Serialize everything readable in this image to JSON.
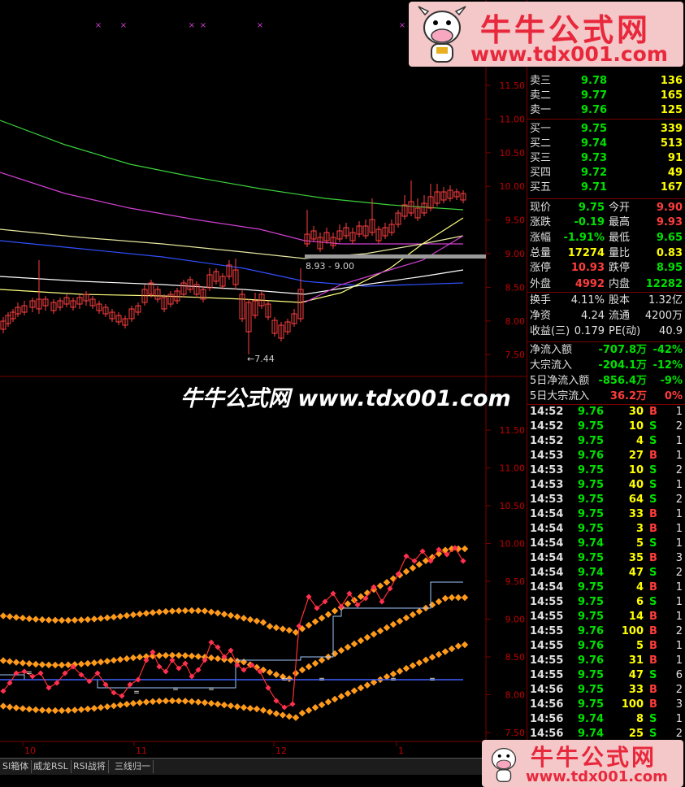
{
  "watermark": {
    "brand": "牛牛公式网",
    "site": "www.tdx001.com",
    "center_text": "牛牛公式网 www.tdx001.com"
  },
  "main_chart": {
    "price_labels": [
      "11.50",
      "11.00",
      "10.50",
      "10.00",
      "9.50",
      "9.00",
      "8.50",
      "8.00",
      "7.50"
    ],
    "low_note": "←7.44",
    "range_note": "8.93 - 9.00"
  },
  "sub_chart": {
    "price_labels": [
      "11.50",
      "11.00",
      "10.50",
      "10.00",
      "9.50",
      "9.00",
      "8.50",
      "8.00",
      "7.50"
    ],
    "date_labels": [
      "10",
      "11",
      "12",
      "1"
    ]
  },
  "tabs": [
    "SI箱体",
    "威龙RSL",
    "RSI战将",
    "三线归一"
  ],
  "order_book": [
    {
      "label": "卖三",
      "price": "9.78",
      "vol": "136"
    },
    {
      "label": "卖二",
      "price": "9.77",
      "vol": "165"
    },
    {
      "label": "卖一",
      "price": "9.76",
      "vol": "125"
    },
    {
      "label": "买一",
      "price": "9.75",
      "vol": "339"
    },
    {
      "label": "买二",
      "price": "9.74",
      "vol": "513"
    },
    {
      "label": "买三",
      "price": "9.73",
      "vol": "91"
    },
    {
      "label": "买四",
      "price": "9.72",
      "vol": "49"
    },
    {
      "label": "买五",
      "price": "9.71",
      "vol": "167"
    }
  ],
  "stats": [
    {
      "l1": "现价",
      "v1": "9.75",
      "l2": "今开",
      "v2": "9.90"
    },
    {
      "l1": "涨跌",
      "v1": "-0.19",
      "l2": "最高",
      "v2": "9.93"
    },
    {
      "l1": "涨幅",
      "v1": "-1.91%",
      "l2": "最低",
      "v2": "9.65"
    },
    {
      "l1": "总量",
      "v1": "17274",
      "l2": "量比",
      "v2": "0.83"
    },
    {
      "l1": "涨停",
      "v1": "10.93",
      "l2": "跌停",
      "v2": "8.95"
    },
    {
      "l1": "外盘",
      "v1": "4992",
      "l2": "内盘",
      "v2": "12282"
    },
    {
      "l1": "换手",
      "v1": "4.11%",
      "l2": "股本",
      "v2": "1.32亿"
    },
    {
      "l1": "净资",
      "v1": "4.24",
      "l2": "流通",
      "v2": "4200万"
    },
    {
      "l1": "收益(三)",
      "v1": "0.179",
      "l2": "PE(动)",
      "v2": "40.9"
    }
  ],
  "flows": [
    {
      "label": "净流入额",
      "val": "-707.8万",
      "pct": "-42%"
    },
    {
      "label": "大宗流入",
      "val": "-204.1万",
      "pct": "-12%"
    },
    {
      "label": "5日净流入额",
      "val": "-856.4万",
      "pct": "-9%"
    },
    {
      "label": "5日大宗流入",
      "val": "36.2万",
      "pct": "0%"
    }
  ],
  "ticks": [
    {
      "t": "14:52",
      "p": "9.76",
      "v": "30",
      "bs": "B",
      "n": "1"
    },
    {
      "t": "14:52",
      "p": "9.75",
      "v": "10",
      "bs": "S",
      "n": "2"
    },
    {
      "t": "14:52",
      "p": "9.75",
      "v": "4",
      "bs": "S",
      "n": "1"
    },
    {
      "t": "14:53",
      "p": "9.76",
      "v": "27",
      "bs": "B",
      "n": "1"
    },
    {
      "t": "14:53",
      "p": "9.75",
      "v": "10",
      "bs": "S",
      "n": "2"
    },
    {
      "t": "14:53",
      "p": "9.75",
      "v": "40",
      "bs": "S",
      "n": "1"
    },
    {
      "t": "14:53",
      "p": "9.75",
      "v": "64",
      "bs": "S",
      "n": "2"
    },
    {
      "t": "14:54",
      "p": "9.75",
      "v": "33",
      "bs": "B",
      "n": "1"
    },
    {
      "t": "14:54",
      "p": "9.75",
      "v": "3",
      "bs": "B",
      "n": "1"
    },
    {
      "t": "14:54",
      "p": "9.74",
      "v": "5",
      "bs": "S",
      "n": "1"
    },
    {
      "t": "14:54",
      "p": "9.75",
      "v": "35",
      "bs": "B",
      "n": "3"
    },
    {
      "t": "14:54",
      "p": "9.74",
      "v": "47",
      "bs": "S",
      "n": "2"
    },
    {
      "t": "14:54",
      "p": "9.75",
      "v": "4",
      "bs": "B",
      "n": "1"
    },
    {
      "t": "14:55",
      "p": "9.75",
      "v": "6",
      "bs": "S",
      "n": "1"
    },
    {
      "t": "14:55",
      "p": "9.75",
      "v": "14",
      "bs": "B",
      "n": "1"
    },
    {
      "t": "14:55",
      "p": "9.76",
      "v": "100",
      "bs": "B",
      "n": "2"
    },
    {
      "t": "14:55",
      "p": "9.76",
      "v": "5",
      "bs": "B",
      "n": "1"
    },
    {
      "t": "14:55",
      "p": "9.76",
      "v": "31",
      "bs": "B",
      "n": "1"
    },
    {
      "t": "14:55",
      "p": "9.75",
      "v": "47",
      "bs": "S",
      "n": "6"
    },
    {
      "t": "14:56",
      "p": "9.75",
      "v": "33",
      "bs": "B",
      "n": "2"
    },
    {
      "t": "14:56",
      "p": "9.75",
      "v": "100",
      "bs": "B",
      "n": "3"
    },
    {
      "t": "14:56",
      "p": "9.74",
      "v": "8",
      "bs": "S",
      "n": "1"
    },
    {
      "t": "14:56",
      "p": "9.74",
      "v": "25",
      "bs": "S",
      "n": "2"
    }
  ]
}
